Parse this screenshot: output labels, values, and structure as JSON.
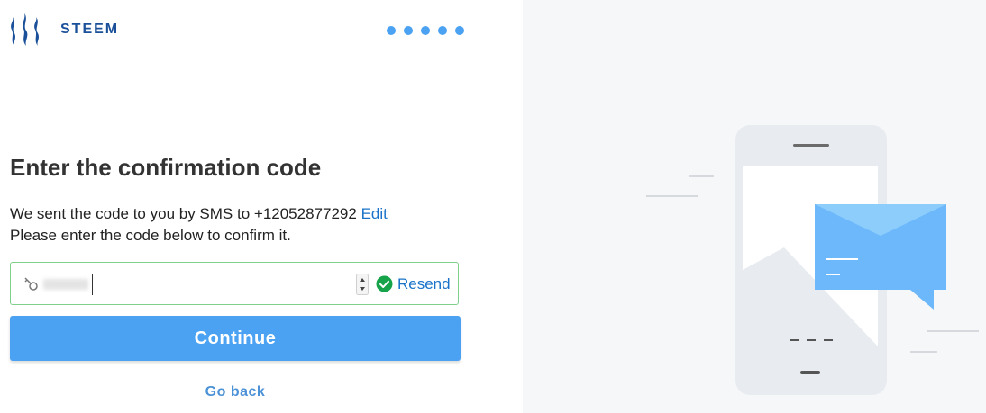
{
  "header": {
    "brand": "STEEM",
    "progress_steps": 5
  },
  "main": {
    "title": "Enter the confirmation code",
    "desc_prefix": "We sent the code to you by SMS to ",
    "phone": "+12052877292",
    "edit_label": "Edit",
    "desc_line2": "Please enter the code below to confirm it.",
    "resend_label": "Resend",
    "continue_label": "Continue",
    "go_back_label": "Go back"
  },
  "icons": {
    "logo": "steem-logo-icon",
    "key": "key-icon",
    "check": "check-circle-icon",
    "spinner": "number-spinner-icon"
  },
  "colors": {
    "brand": "#1a5099",
    "accent": "#4ba2f2",
    "link": "#1a73c9",
    "success": "#17a34a",
    "valid_border": "#7ed08a",
    "illustration_bg": "#f6f7f8"
  }
}
